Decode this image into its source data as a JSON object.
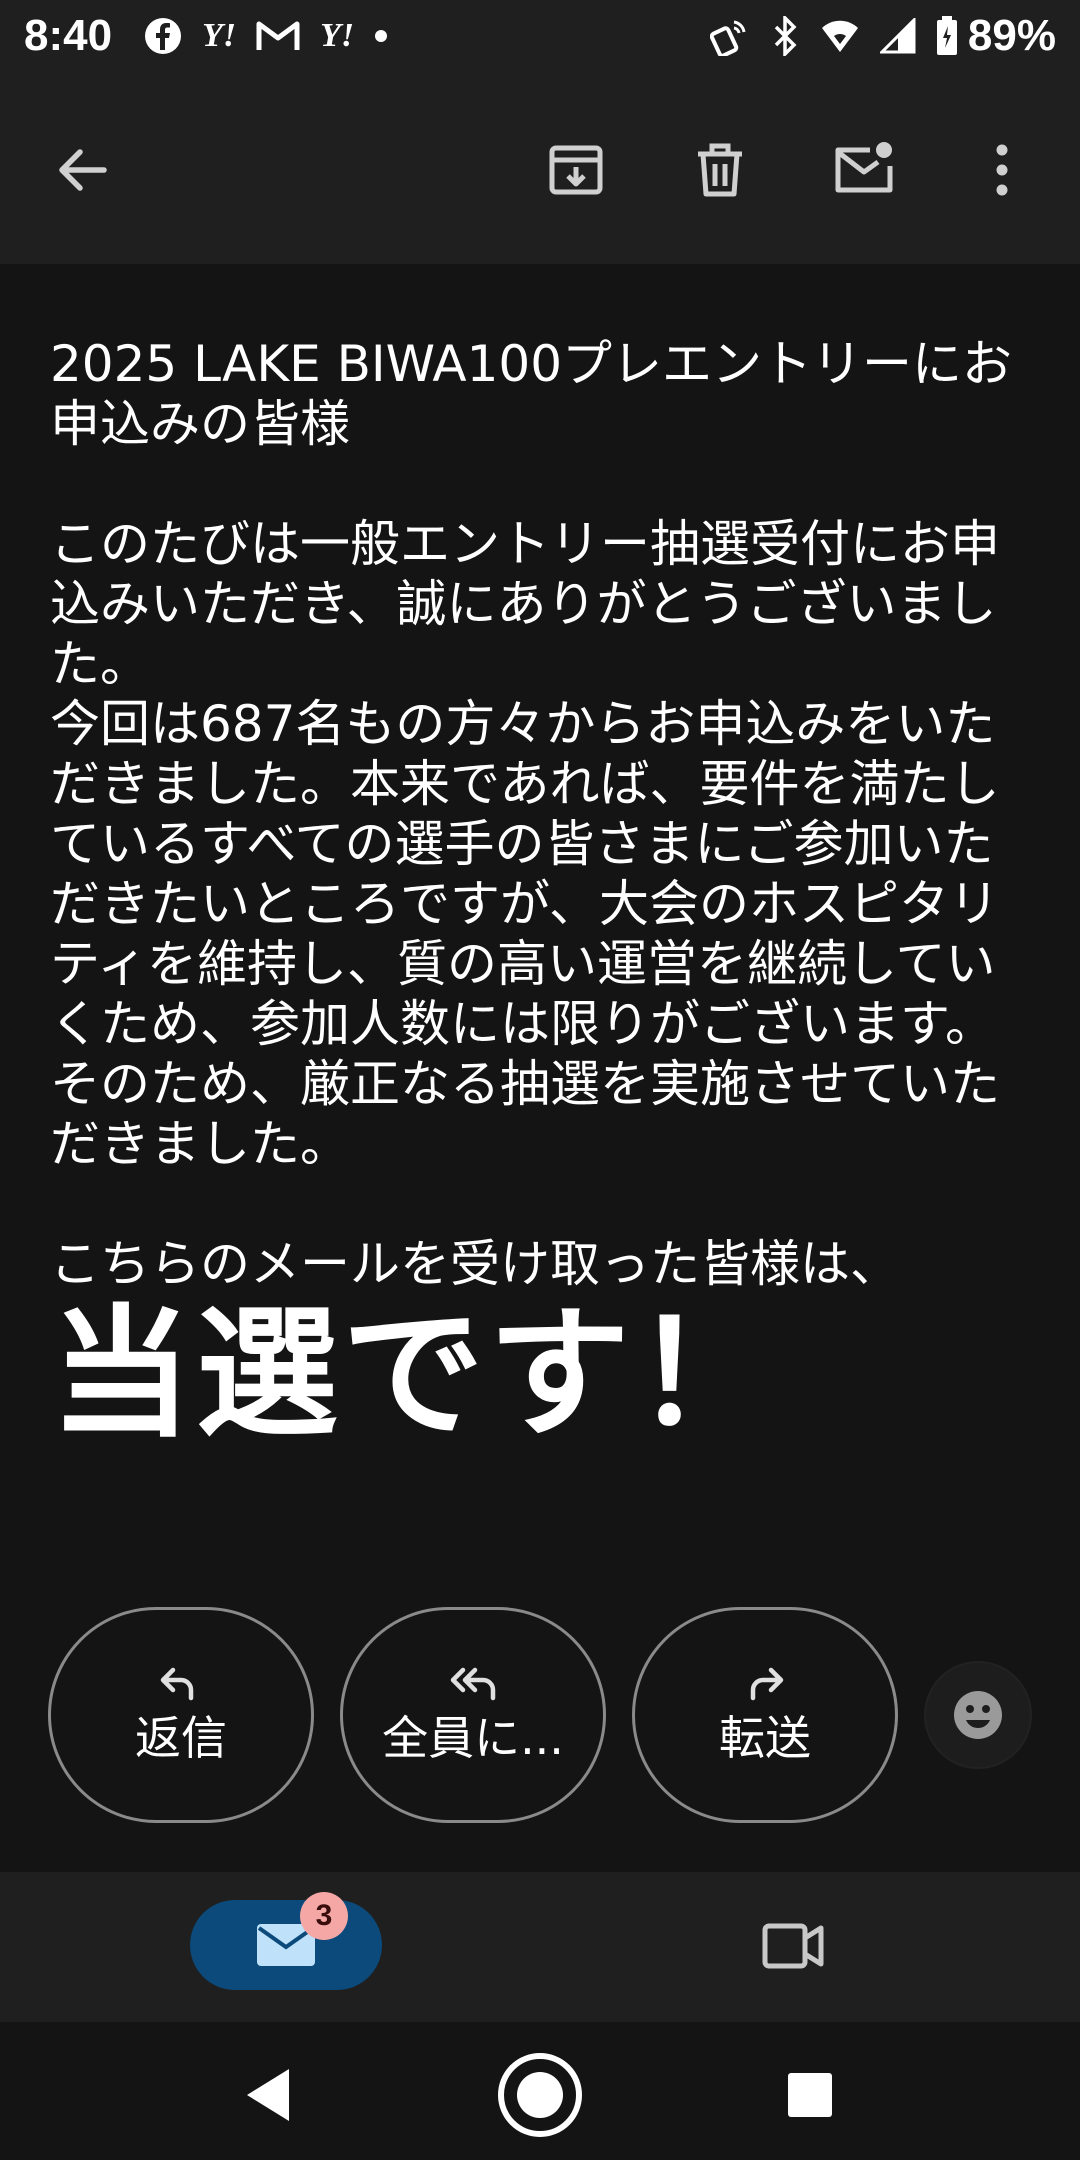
{
  "status_bar": {
    "time": "8:40",
    "notification_icons": [
      "facebook-icon",
      "yahoo-icon",
      "gmail-icon",
      "yahoo-icon",
      "dot-icon"
    ],
    "yahoo_text": "Y!",
    "battery": "89%"
  },
  "toolbar": {
    "back": "back-arrow-icon",
    "archive": "archive-icon",
    "delete": "delete-icon",
    "mark_unread": "mark-unread-icon",
    "more": "more-vert-icon"
  },
  "email": {
    "body": "2025 LAKE BIWA100プレエントリーにお申込みの皆様\n\nこのたびは一般エントリー抽選受付にお申込みいただき、誠にありがとうございました。\n今回は687名もの方々からお申込みをいただきました。本来であれば、要件を満たしているすべての選手の皆さまにご参加いただきたいところですが、大会のホスピタリティを維持し、質の高い運営を継続していくため、参加人数には限りがございます。\nそのため、厳正なる抽選を実施させていただきました。\n\nこちらのメールを受け取った皆様は、",
    "headline": "当選です！"
  },
  "actions": {
    "reply_label": "返信",
    "reply_all_label": "全員に...",
    "forward_label": "転送"
  },
  "bottom_nav": {
    "mail_badge": "3"
  },
  "colors": {
    "background": "#141414",
    "bar": "#1f1f1f",
    "mail_tab": "#0b4a7a",
    "badge": "#f4a7a5"
  }
}
